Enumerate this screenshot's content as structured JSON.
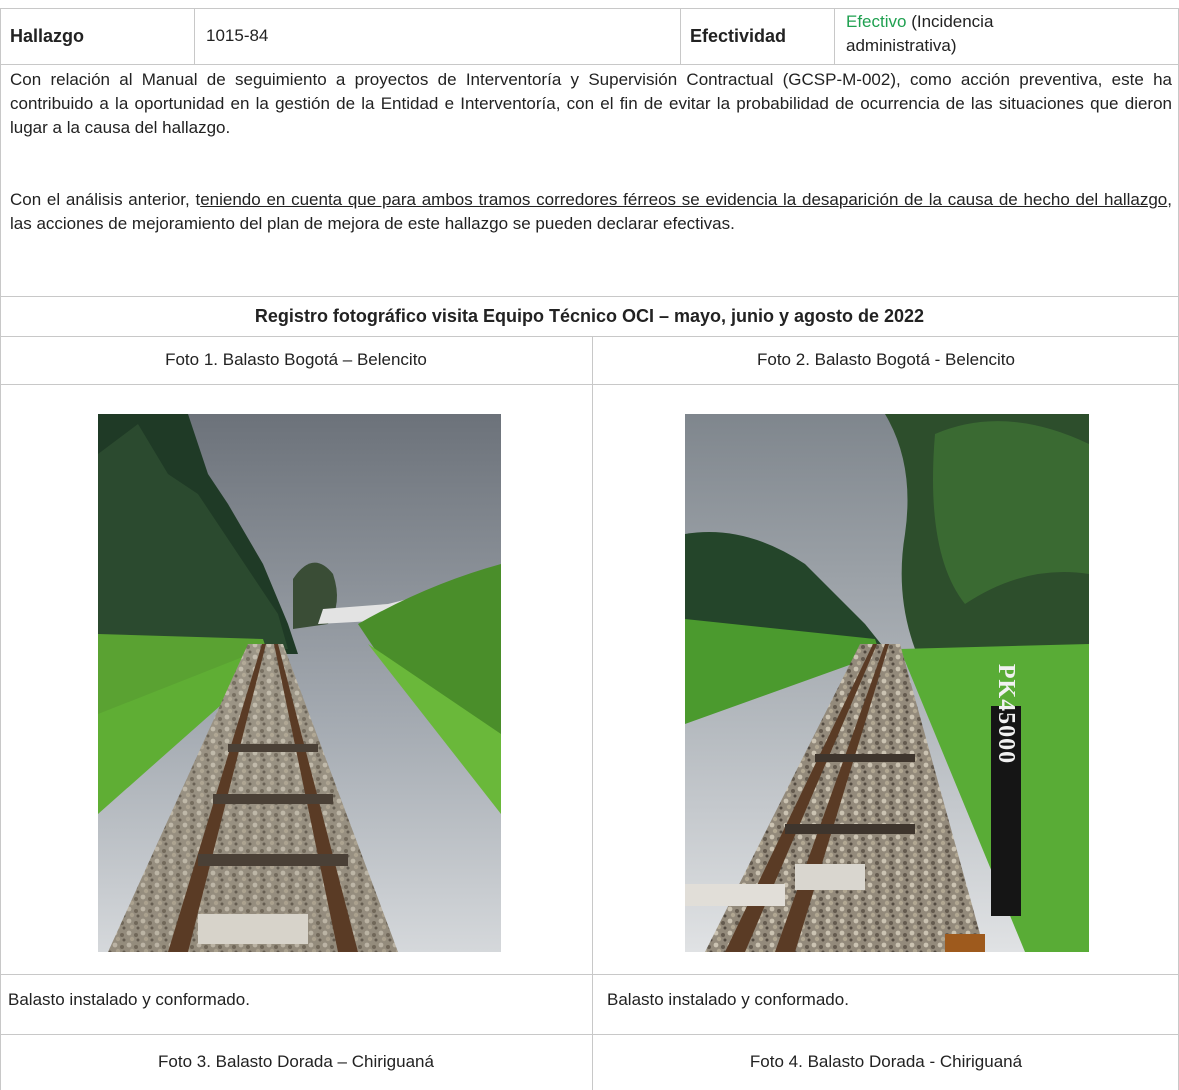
{
  "header": {
    "label_hallazgo": "Hallazgo",
    "code": "1015-84",
    "label_efectividad": "Efectividad",
    "status_word": "Efectivo",
    "status_rest_line1": " (Incidencia",
    "status_rest_line2": "administrativa)",
    "status_color": "#1fa050"
  },
  "body": {
    "paragraph1": "Con relación al Manual de seguimiento a proyectos de Interventoría y Supervisión Contractual (GCSP-M-002), como acción preventiva, este ha contribuido a la oportunidad en la gestión de la Entidad e Interventoría, con el fin de evitar la probabilidad de ocurrencia de las situaciones que dieron lugar a la causa del hallazgo.",
    "paragraph2_prefix": "Con el análisis anterior, t",
    "paragraph2_underlined": "eniendo en cuenta que para ambos tramos corredores férreos se evidencia la desaparición de la causa de hecho del hallazgo",
    "paragraph2_suffix": ", las acciones de mejoramiento del plan de mejora de este hallazgo se pueden declarar efectivas."
  },
  "photos_section": {
    "title": "Registro fotográfico visita Equipo Técnico OCI – mayo, junio y agosto de 2022",
    "photo1_caption": "Foto 1. Balasto Bogotá – Belencito",
    "photo2_caption": "Foto 2. Balasto Bogotá - Belencito",
    "photo1_note": "Balasto instalado y conformado.",
    "photo2_note": "Balasto instalado y conformado.",
    "photo3_caption": "Foto 3. Balasto Dorada – Chiriguaná",
    "photo4_caption": "Foto 4. Balasto Dorada - Chiriguaná",
    "marker_text": "PK45000"
  }
}
